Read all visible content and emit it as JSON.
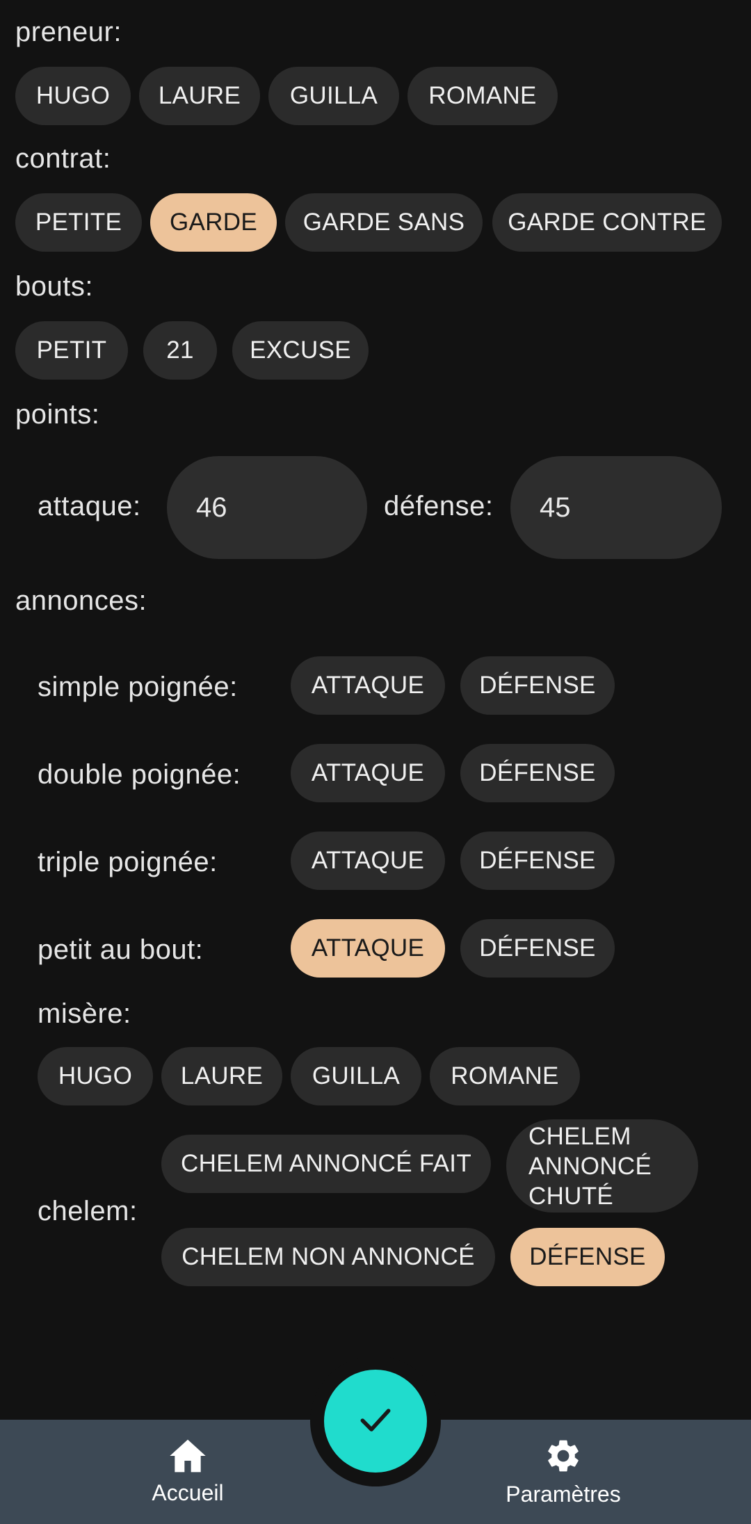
{
  "sections": {
    "preneur": "preneur:",
    "contrat": "contrat:",
    "bouts": "bouts:",
    "points": "points:",
    "annonces": "annonces:"
  },
  "players": [
    "HUGO",
    "LAURE",
    "GUILLA",
    "ROMANE"
  ],
  "contracts": [
    "PETITE",
    "GARDE",
    "GARDE SANS",
    "GARDE CONTRE"
  ],
  "selected_contract": "GARDE",
  "bouts": [
    "PETIT",
    "21",
    "EXCUSE"
  ],
  "points": {
    "attack_label": "attaque:",
    "attack_value": "46",
    "defense_label": "défense:",
    "defense_value": "45"
  },
  "annonces": {
    "attack_option": "ATTAQUE",
    "defense_option": "DÉFENSE",
    "simple": "simple poignée:",
    "double": "double poignée:",
    "triple": "triple poignée:",
    "petit_au_bout": "petit au bout:",
    "petit_au_bout_selected": "ATTAQUE",
    "misere": "misère:",
    "chelem": "chelem:"
  },
  "chelem_options": {
    "announced_made": "CHELEM ANNONCÉ FAIT",
    "announced_failed_lines": [
      "CHELEM",
      "ANNONCÉ",
      "CHUTÉ"
    ],
    "not_announced": "CHELEM NON ANNONCÉ",
    "defense": "DÉFENSE",
    "selected": "DÉFENSE"
  },
  "nav": {
    "home_label": "Accueil",
    "settings_label": "Paramètres",
    "home_icon": "home-icon",
    "settings_icon": "gear-icon",
    "confirm_icon": "check-icon"
  },
  "colors": {
    "background": "#121212",
    "chip": "#2b2b2b",
    "chip_selected": "#edc39a",
    "fab": "#20dccd",
    "bottom_bar": "#3d4955"
  }
}
